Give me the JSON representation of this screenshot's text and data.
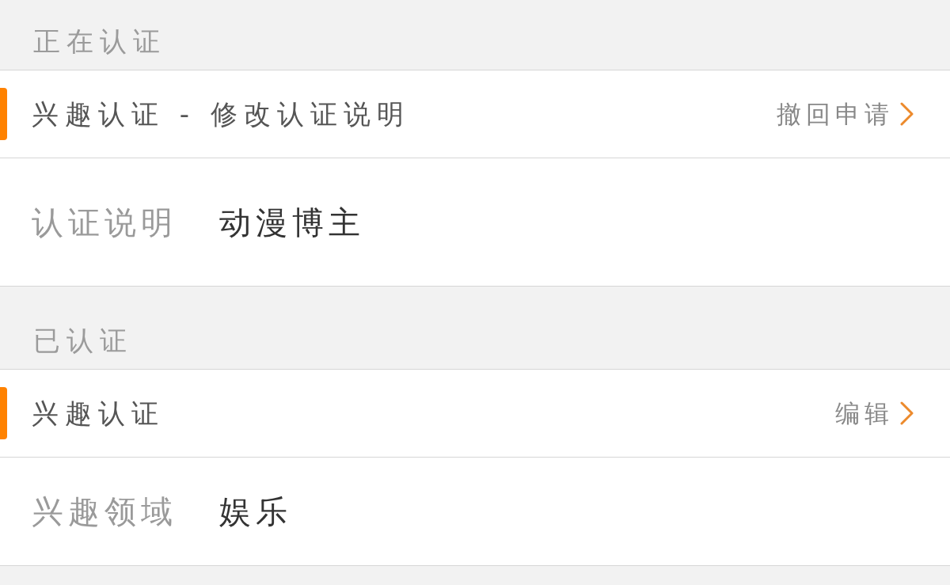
{
  "sections": [
    {
      "title": "正在认证",
      "rows": [
        {
          "kind": "header",
          "title": "兴趣认证 - 修改认证说明",
          "action": "撤回申请"
        },
        {
          "kind": "field",
          "label": "认证说明",
          "value": "动漫博主"
        }
      ]
    },
    {
      "title": "已认证",
      "rows": [
        {
          "kind": "header",
          "title": "兴趣认证",
          "action": "编辑"
        },
        {
          "kind": "field",
          "label": "兴趣领域",
          "value": "娱乐"
        }
      ]
    }
  ]
}
